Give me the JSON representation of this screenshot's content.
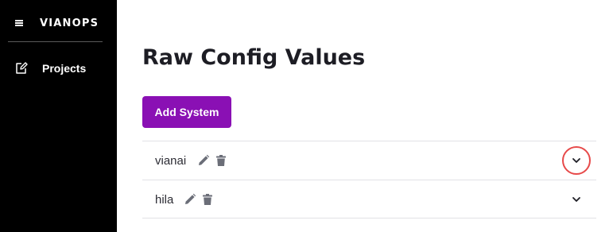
{
  "sidebar": {
    "brand": "VIANOPS",
    "menu_icon": "hamburger-menu-icon",
    "items": [
      {
        "label": "Projects",
        "icon": "edit-document-icon"
      }
    ]
  },
  "main": {
    "title": "Raw Config Values",
    "add_button_label": "Add System",
    "systems": [
      {
        "name": "vianai",
        "edit_icon": "pencil-icon",
        "delete_icon": "trash-icon",
        "expand_icon": "chevron-down-icon",
        "highlighted": true
      },
      {
        "name": "hila",
        "edit_icon": "pencil-icon",
        "delete_icon": "trash-icon",
        "expand_icon": "chevron-down-icon",
        "highlighted": false
      }
    ]
  },
  "colors": {
    "sidebar_bg": "#000000",
    "accent": "#8a10b4",
    "highlight": "#e74a4a",
    "icon_gray": "#6b6e78"
  }
}
